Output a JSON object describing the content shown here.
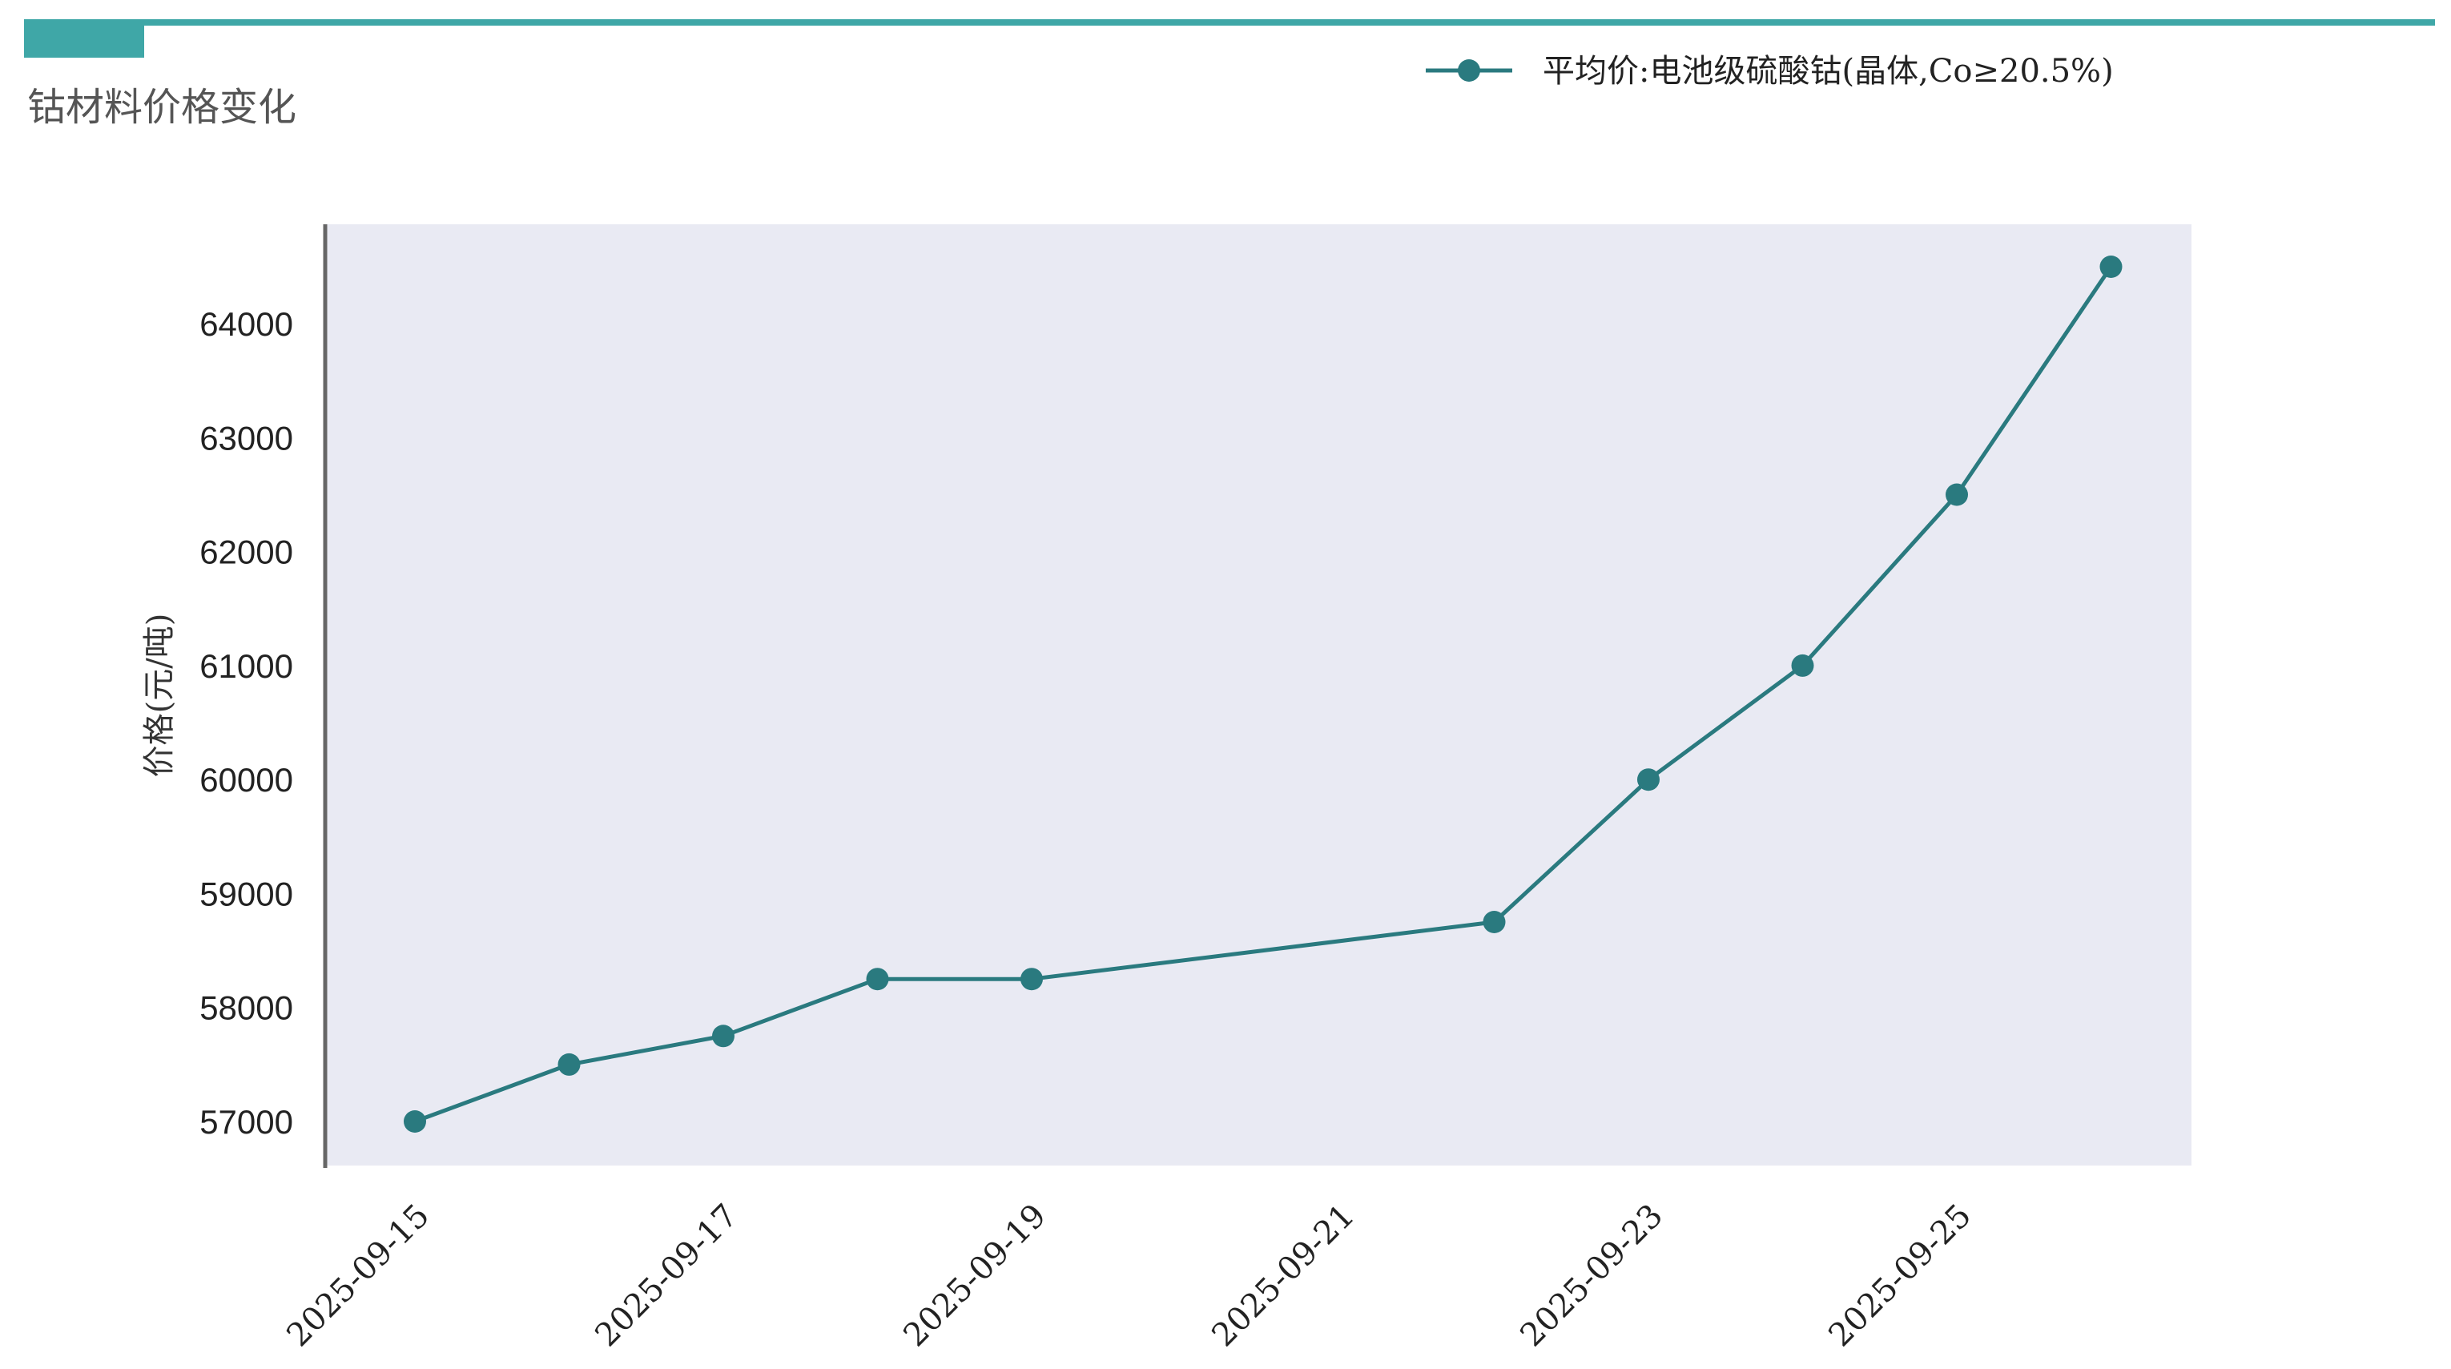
{
  "header": {
    "title": "钴材料价格变化",
    "accent_color": "#3fa7a7"
  },
  "chart_data": {
    "type": "line",
    "title": "",
    "xlabel": "",
    "ylabel": "价格(元/吨)",
    "x": [
      "2025-09-15",
      "2025-09-16",
      "2025-09-17",
      "2025-09-18",
      "2025-09-19",
      "2025-09-22",
      "2025-09-23",
      "2025-09-24",
      "2025-09-25",
      "2025-09-26"
    ],
    "x_ticks": [
      "2025-09-15",
      "2025-09-17",
      "2025-09-19",
      "2025-09-21",
      "2025-09-23",
      "2025-09-25"
    ],
    "xlim": [
      "2025-09-14",
      "2025-09-26"
    ],
    "y_ticks": [
      57000,
      58000,
      59000,
      60000,
      61000,
      62000,
      63000,
      64000
    ],
    "ylim": [
      56600,
      64900
    ],
    "series": [
      {
        "name": "平均价:电池级硫酸钴(晶体,Co≥20.5%)",
        "values": [
          57000,
          57500,
          57750,
          58250,
          58250,
          58750,
          60000,
          61000,
          62500,
          64500
        ],
        "color": "#2a7a7f"
      }
    ],
    "plot_background": "#e9eaf3",
    "grid": false,
    "legend_position": "top-right",
    "marker": "circle"
  }
}
